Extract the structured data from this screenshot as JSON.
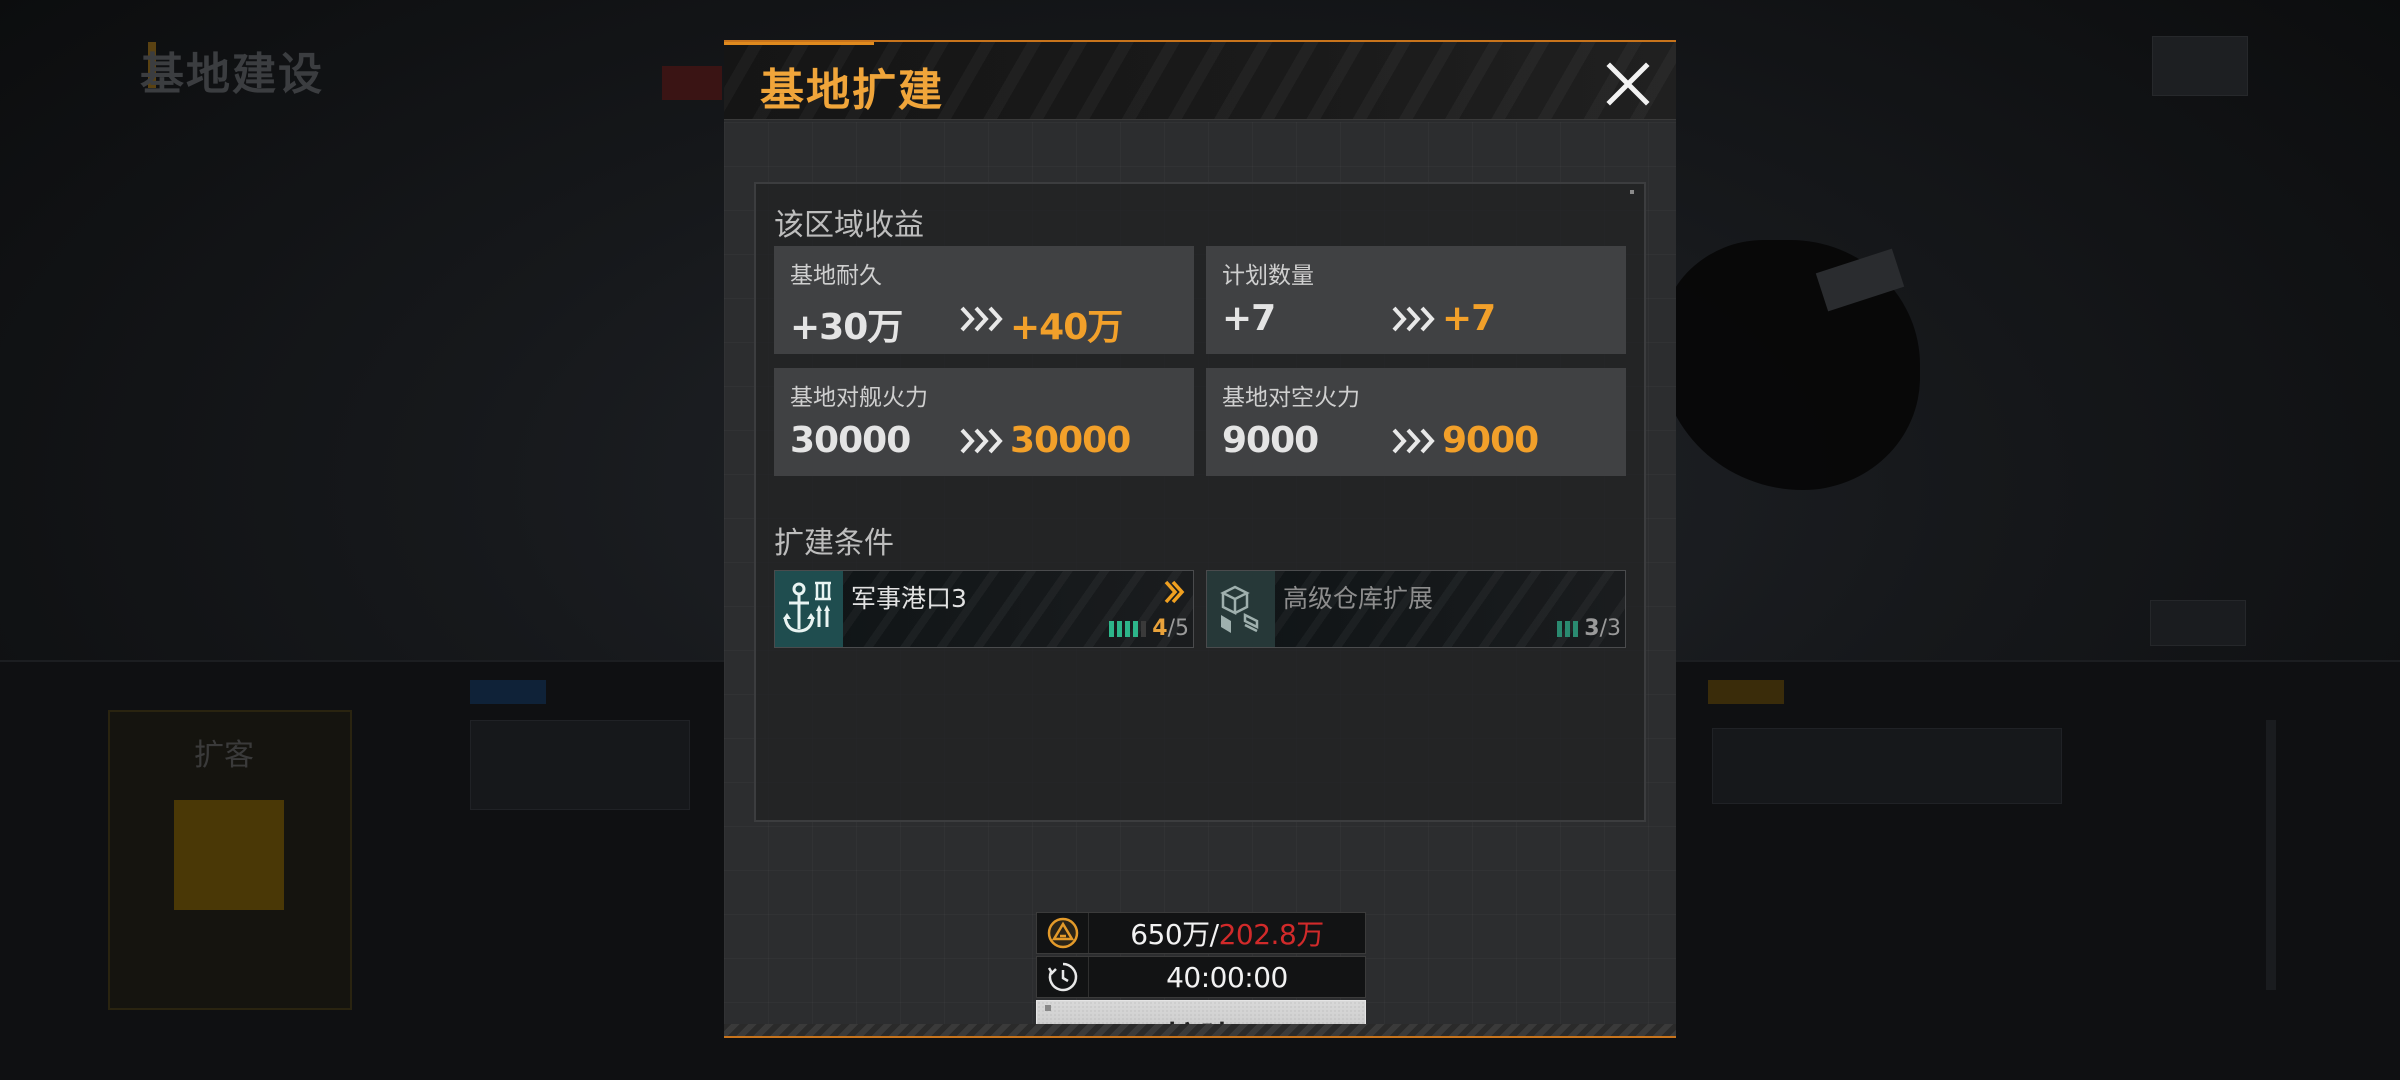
{
  "background": {
    "title": "基地建设",
    "left_card_label": "扩客"
  },
  "modal": {
    "title": "基地扩建",
    "close_icon": "close-icon",
    "accent_color": "#f0a53a",
    "section_gains": "该区域收益",
    "stats": [
      {
        "name": "基地耐久",
        "current": "+30万",
        "next": "+40万"
      },
      {
        "name": "计划数量",
        "current": "+7",
        "next": "+7"
      },
      {
        "name": "基地对舰火力",
        "current": "30000",
        "next": "30000"
      },
      {
        "name": "基地对空火力",
        "current": "9000",
        "next": "9000"
      }
    ],
    "section_conditions": "扩建条件",
    "conditions": [
      {
        "name": "军事港口3",
        "icon": "anchor-icon",
        "progress_current": "4",
        "progress_total": "/5",
        "progress_fraction": 0.8
      },
      {
        "name": "高级仓库扩展",
        "icon": "cubes-icon",
        "progress_current": "3",
        "progress_total": "/3",
        "progress_fraction": 1.0
      }
    ],
    "cost": {
      "resource_icon": "triangle-resource-icon",
      "owned": "650万/",
      "required": "202.8万",
      "timer_icon": "timer-icon",
      "time": "40:00:00"
    },
    "expand_button": "扩建"
  }
}
